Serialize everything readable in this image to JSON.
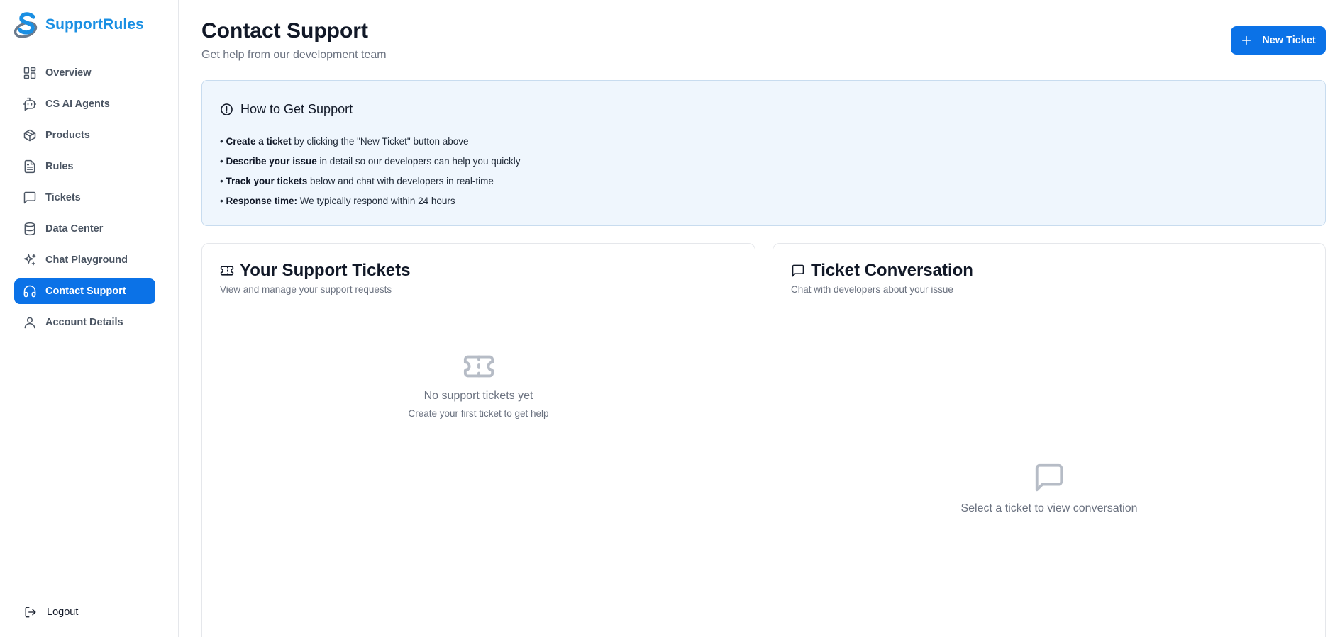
{
  "app": {
    "name": "SupportRules"
  },
  "sidebar": {
    "items": [
      {
        "label": "Overview",
        "icon": "grid-icon"
      },
      {
        "label": "CS AI Agents",
        "icon": "bot-icon"
      },
      {
        "label": "Products",
        "icon": "box-icon"
      },
      {
        "label": "Rules",
        "icon": "document-icon"
      },
      {
        "label": "Tickets",
        "icon": "message-icon"
      },
      {
        "label": "Data Center",
        "icon": "database-icon"
      },
      {
        "label": "Chat Playground",
        "icon": "sparkles-icon"
      },
      {
        "label": "Contact Support",
        "icon": "headphones-icon",
        "active": true
      },
      {
        "label": "Account Details",
        "icon": "user-icon"
      }
    ],
    "logout_label": "Logout"
  },
  "header": {
    "title": "Contact Support",
    "subtitle": "Get help from our development team",
    "new_ticket_label": "New Ticket"
  },
  "info": {
    "title": "How to Get Support",
    "lines": [
      {
        "bold": "Create a ticket",
        "text": " by clicking the \"New Ticket\" button above"
      },
      {
        "bold": "Describe your issue",
        "text": " in detail so our developers can help you quickly"
      },
      {
        "bold": "Track your tickets",
        "text": " below and chat with developers in real-time"
      },
      {
        "bold": "Response time:",
        "text": " We typically respond within 24 hours"
      }
    ]
  },
  "tickets_panel": {
    "title": "Your Support Tickets",
    "subtitle": "View and manage your support requests",
    "empty_title": "No support tickets yet",
    "empty_subtitle": "Create your first ticket to get help"
  },
  "conversation_panel": {
    "title": "Ticket Conversation",
    "subtitle": "Chat with developers about your issue",
    "empty_text": "Select a ticket to view conversation"
  },
  "colors": {
    "accent": "#0b72e7",
    "brand": "#1a8fe3",
    "info_bg": "#eff6fd",
    "muted_text": "#6b7280"
  }
}
